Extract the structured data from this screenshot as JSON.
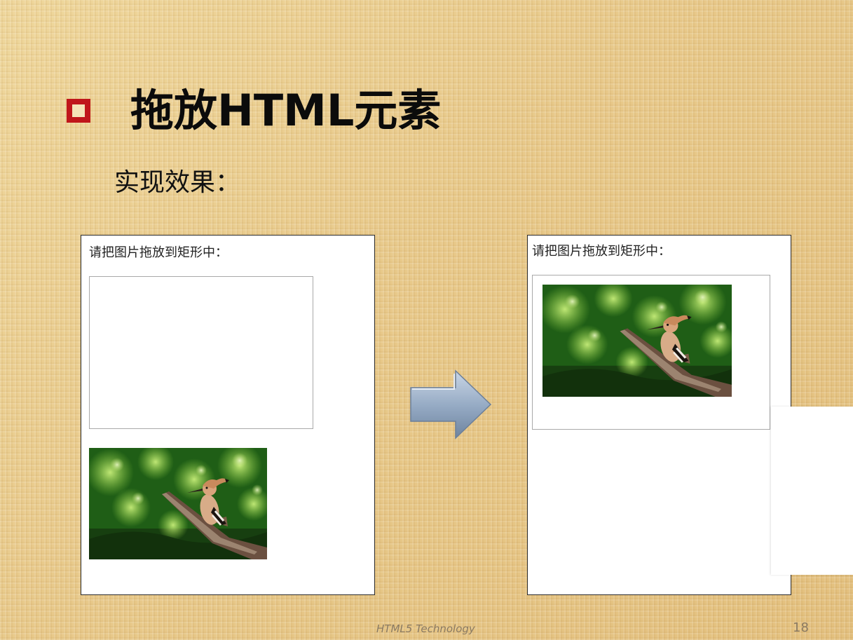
{
  "slide": {
    "title": "拖放HTML元素",
    "subtitle": "实现效果：",
    "footer": "HTML5 Technology",
    "page_number": "18"
  },
  "panels": {
    "before": {
      "prompt": "请把图片拖放到矩形中："
    },
    "after": {
      "prompt": "请把图片拖放到矩形中："
    }
  },
  "colors": {
    "bullet": "#c0161b",
    "arrow": "#8fa3bd"
  },
  "icons": {
    "bullet": "square-bullet-icon",
    "arrow": "right-arrow-icon"
  }
}
